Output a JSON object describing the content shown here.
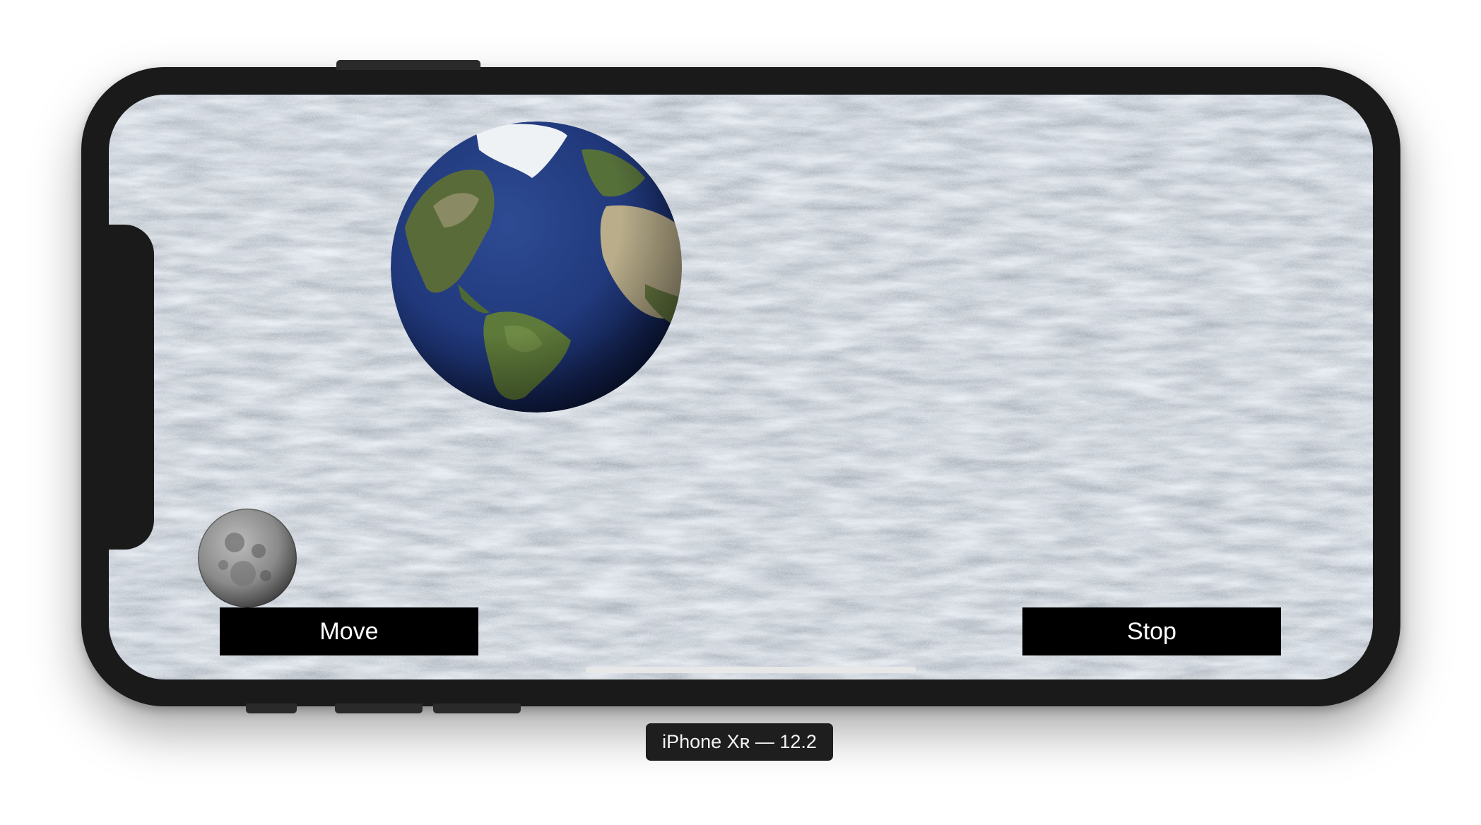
{
  "simulator": {
    "device_label": "iPhone Xʀ — 12.2"
  },
  "app": {
    "buttons": {
      "move_label": "Move",
      "stop_label": "Stop"
    },
    "objects": {
      "earth_icon": "earth-globe",
      "moon_icon": "moon"
    }
  },
  "colors": {
    "device_frame": "#1a1a1a",
    "button_bg": "#000000",
    "button_text": "#ffffff",
    "sky_texture": "#8b959e"
  }
}
